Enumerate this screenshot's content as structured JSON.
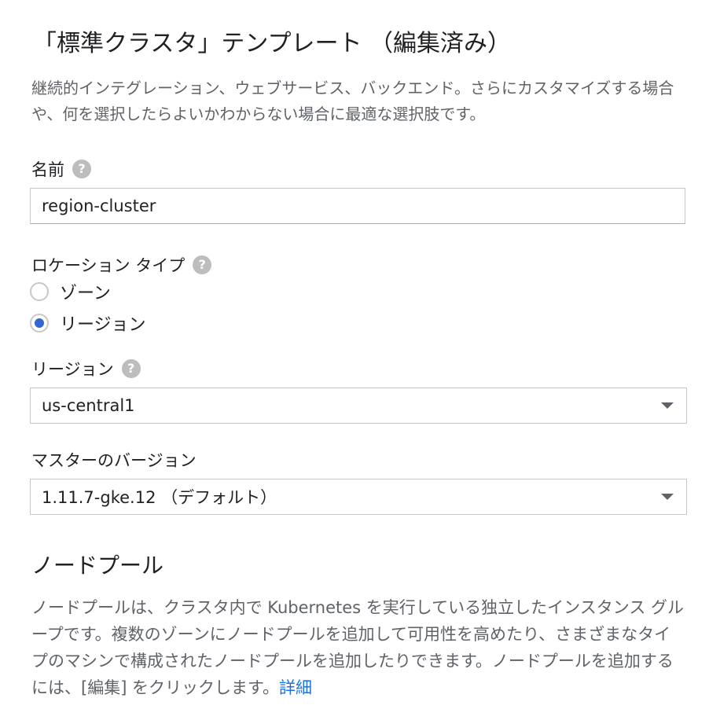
{
  "header": {
    "title": "「標準クラスタ」テンプレート （編集済み）",
    "description": "継続的インテグレーション、ウェブサービス、バックエンド。さらにカスタマイズする場合や、何を選択したらよいかわからない場合に最適な選択肢です。"
  },
  "name_field": {
    "label": "名前",
    "help_icon": "help-icon",
    "value": "region-cluster"
  },
  "location_type": {
    "label": "ロケーション タイプ",
    "help_icon": "help-icon",
    "options": [
      {
        "label": "ゾーン",
        "checked": false
      },
      {
        "label": "リージョン",
        "checked": true
      }
    ]
  },
  "region": {
    "label": "リージョン",
    "help_icon": "help-icon",
    "selected": "us-central1"
  },
  "master_version": {
    "label": "マスターのバージョン",
    "selected": "1.11.7-gke.12 （デフォルト）"
  },
  "node_pools": {
    "title": "ノードプール",
    "description": "ノードプールは、クラスタ内で Kubernetes を実行している独立したインスタンス グループです。複数のゾーンにノードプールを追加して可用性を高めたり、さまざまなタイプのマシンで構成されたノードプールを追加したりできます。ノードプールを追加するには、[編集] をクリックします。",
    "link_text": "詳細"
  },
  "colors": {
    "accent": "#3367d6",
    "link": "#1a73e8",
    "secondary_text": "#5f6368"
  }
}
